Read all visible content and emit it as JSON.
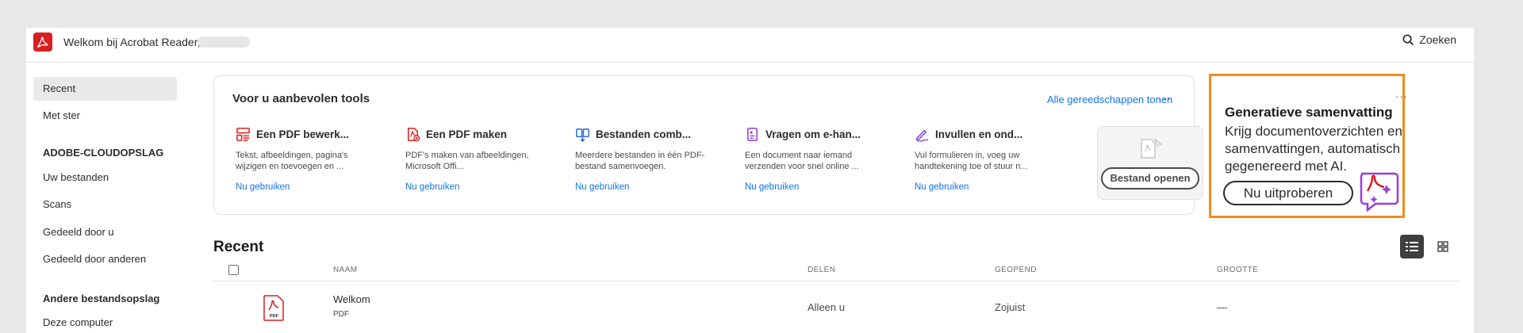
{
  "app": {
    "title": "Welkom bij Acrobat Reader,",
    "search_label": "Zoeken"
  },
  "sidebar": {
    "items_top": [
      {
        "label": "Recent",
        "active": true
      },
      {
        "label": "Met ster",
        "active": false
      }
    ],
    "cloud_header": "ADOBE-CLOUDOPSLAG",
    "cloud_items": [
      {
        "label": "Uw bestanden"
      },
      {
        "label": "Scans"
      },
      {
        "label": "Gedeeld door u"
      },
      {
        "label": "Gedeeld door anderen"
      }
    ],
    "other_header": "Andere bestandsopslag",
    "other_items": [
      {
        "label": "Deze computer"
      }
    ]
  },
  "tools": {
    "title": "Voor u aanbevolen tools",
    "all_tools_link": "Alle gereedschappen tonen",
    "more": "···",
    "items": [
      {
        "title": "Een PDF bewerk...",
        "desc": "Tekst, afbeeldingen, pagina's wijzigen en toevoegen en ...",
        "link": "Nu gebruiken",
        "icon": "edit-pdf-icon",
        "color": "#d7201f"
      },
      {
        "title": "Een PDF maken",
        "desc": "PDF's maken van afbeeldingen, Microsoft Offi...",
        "link": "Nu gebruiken",
        "icon": "create-pdf-icon",
        "color": "#d7201f"
      },
      {
        "title": "Bestanden comb...",
        "desc": "Meerdere bestanden in één PDF-bestand samenvoegen.",
        "link": "Nu gebruiken",
        "icon": "combine-files-icon",
        "color": "#2d6bd6"
      },
      {
        "title": "Vragen om e-han...",
        "desc": "Een document naar iemand verzenden voor snel online ...",
        "link": "Nu gebruiken",
        "icon": "request-esign-icon",
        "color": "#8a3fd1"
      },
      {
        "title": "Invullen en ond...",
        "desc": "Vul formulieren in, voeg uw handtekening toe of stuur n...",
        "link": "Nu gebruiken",
        "icon": "fill-sign-icon",
        "color": "#8a3fd1"
      }
    ],
    "open_file_button": "Bestand openen"
  },
  "promo": {
    "title": "Generatieve samenvatting",
    "body": "Krijg documentoverzichten en samenvattingen, automatisch gegenereerd met AI.",
    "button": "Nu uitproberen",
    "more": "···"
  },
  "recent": {
    "title": "Recent",
    "columns": {
      "name": "NAAM",
      "share": "DELEN",
      "opened": "GEOPEND",
      "size": "GROOTTE"
    },
    "rows": [
      {
        "name": "Welkom",
        "type": "PDF",
        "share": "Alleen u",
        "opened": "Zojuist",
        "size": "—"
      }
    ]
  },
  "colors": {
    "accent_link": "#1473e6",
    "acrobat_red": "#d7201f",
    "promo_border": "#f28c1a"
  }
}
